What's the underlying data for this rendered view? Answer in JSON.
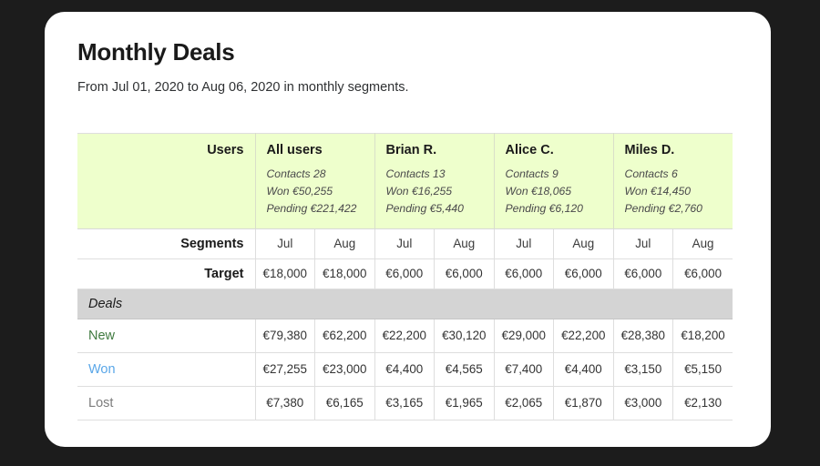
{
  "header": {
    "title": "Monthly Deals",
    "subtitle": "From Jul 01, 2020 to Aug 06, 2020 in monthly segments."
  },
  "table": {
    "users_label": "Users",
    "segments_label": "Segments",
    "target_label": "Target",
    "section_label": "Deals",
    "users": [
      {
        "name": "All users",
        "contacts": "Contacts 28",
        "won": "Won €50,255",
        "pending": "Pending €221,422"
      },
      {
        "name": "Brian R.",
        "contacts": "Contacts 13",
        "won": "Won €16,255",
        "pending": "Pending €5,440"
      },
      {
        "name": "Alice C.",
        "contacts": "Contacts 9",
        "won": "Won €18,065",
        "pending": "Pending €6,120"
      },
      {
        "name": "Miles D.",
        "contacts": "Contacts 6",
        "won": "Won €14,450",
        "pending": "Pending €2,760"
      }
    ],
    "segments": [
      "Jul",
      "Aug",
      "Jul",
      "Aug",
      "Jul",
      "Aug",
      "Jul",
      "Aug"
    ],
    "target": [
      "€18,000",
      "€18,000",
      "€6,000",
      "€6,000",
      "€6,000",
      "€6,000",
      "€6,000",
      "€6,000"
    ],
    "deal_rows": [
      {
        "label": "New",
        "color": "#3f7a3f",
        "values": [
          "€79,380",
          "€62,200",
          "€22,200",
          "€30,120",
          "€29,000",
          "€22,200",
          "€28,380",
          "€18,200"
        ]
      },
      {
        "label": "Won",
        "color": "#5aa7e8",
        "values": [
          "€27,255",
          "€23,000",
          "€4,400",
          "€4,565",
          "€7,400",
          "€4,400",
          "€3,150",
          "€5,150"
        ]
      },
      {
        "label": "Lost",
        "color": "#7c7c7c",
        "values": [
          "€7,380",
          "€6,165",
          "€3,165",
          "€1,965",
          "€2,065",
          "€1,870",
          "€3,000",
          "€2,130"
        ]
      }
    ]
  },
  "chart_data": {
    "type": "table",
    "title": "Monthly Deals",
    "subtitle": "From Jul 01, 2020 to Aug 06, 2020 in monthly segments.",
    "columns": [
      "All users Jul",
      "All users Aug",
      "Brian R. Jul",
      "Brian R. Aug",
      "Alice C. Jul",
      "Alice C. Aug",
      "Miles D. Jul",
      "Miles D. Aug"
    ],
    "rows": [
      {
        "name": "Target",
        "values": [
          18000,
          18000,
          6000,
          6000,
          6000,
          6000,
          6000,
          6000
        ]
      },
      {
        "name": "New",
        "values": [
          79380,
          62200,
          22200,
          30120,
          29000,
          22200,
          28380,
          18200
        ]
      },
      {
        "name": "Won",
        "values": [
          27255,
          23000,
          4400,
          4565,
          7400,
          4400,
          3150,
          5150
        ]
      },
      {
        "name": "Lost",
        "values": [
          7380,
          6165,
          3165,
          1965,
          2065,
          1870,
          3000,
          2130
        ]
      }
    ],
    "user_summary": [
      {
        "user": "All users",
        "contacts": 28,
        "won": 50255,
        "pending": 221422
      },
      {
        "user": "Brian R.",
        "contacts": 13,
        "won": 16255,
        "pending": 5440
      },
      {
        "user": "Alice C.",
        "contacts": 9,
        "won": 18065,
        "pending": 6120
      },
      {
        "user": "Miles D.",
        "contacts": 6,
        "won": 14450,
        "pending": 2760
      }
    ],
    "currency": "EUR"
  },
  "colors": {
    "header_band": "#eeffcc",
    "section_band": "#d4d4d4",
    "new": "#3f7a3f",
    "won": "#5aa7e8",
    "lost": "#7c7c7c"
  }
}
